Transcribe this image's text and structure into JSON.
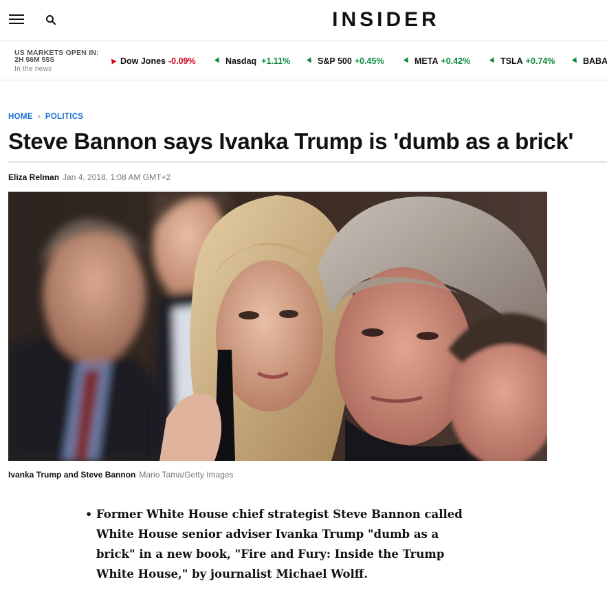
{
  "nav": {
    "logo": "INSIDER",
    "menu_icon": "hamburger-menu-icon",
    "search_icon": "search-icon"
  },
  "markets": {
    "title": "US MARKETS OPEN IN:",
    "timer": "2H 56M 55S",
    "subtitle": "In the news",
    "tickers": [
      {
        "name": "Dow Jones",
        "change": "-0.09%",
        "direction": "down"
      },
      {
        "name": "Nasdaq",
        "change": "+1.11%",
        "direction": "up"
      },
      {
        "name": "S&P 500",
        "change": "+0.45%",
        "direction": "up"
      },
      {
        "name": "META",
        "change": "+0.42%",
        "direction": "up"
      },
      {
        "name": "TSLA",
        "change": "+0.74%",
        "direction": "up"
      },
      {
        "name": "BABA",
        "change": "",
        "direction": "up"
      }
    ],
    "colors": {
      "down": "#d0021b",
      "up": "#0a8a3a"
    }
  },
  "breadcrumb": {
    "home": "HOME",
    "section": "POLITICS"
  },
  "article": {
    "title": "Steve Bannon says Ivanka Trump is 'dumb as a brick'",
    "author": "Eliza Relman",
    "date": "Jan 4, 2018, 1:08 AM GMT+2",
    "image_caption": "Ivanka Trump and Steve Bannon",
    "image_credit": "Mario Tama/Getty Images",
    "summary": [
      "Former White House chief strategist Steve Bannon called White House senior adviser Ivanka Trump \"dumb as a brick\" in a new book, \"Fire and Fury: Inside the Trump White House,\" by journalist Michael Wolff."
    ]
  },
  "accent_color": "#1a6fd1"
}
